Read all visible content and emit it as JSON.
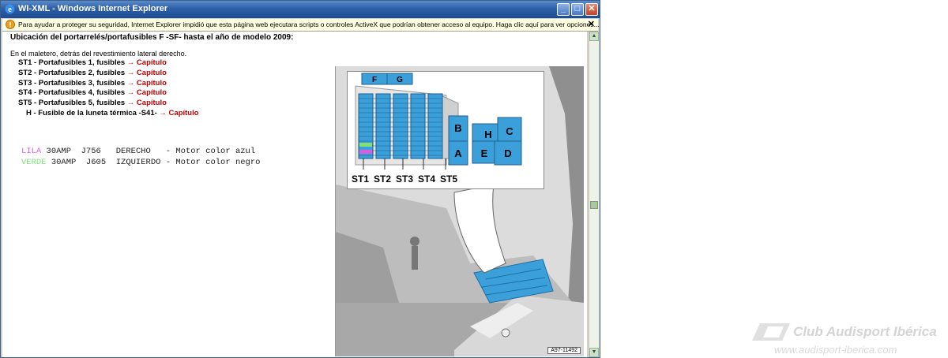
{
  "window": {
    "title": "WI-XML - Windows Internet Explorer"
  },
  "infobar": {
    "text": "Para ayudar a proteger su seguridad, Internet Explorer impidió que esta página web ejecutara scripts o controles ActiveX que podrían obtener acceso al equipo. Haga clic aquí para ver opciones...",
    "close": "✕"
  },
  "page": {
    "heading": "Ubicación del portarrelés/portafusibles F -SF- hasta el año de modelo 2009:",
    "location": "En el maletero, detrás del revestimiento lateral derecho.",
    "items": [
      {
        "label": "ST1 - Portafusibles 1, fusibles",
        "link": "→ Capítulo"
      },
      {
        "label": "ST2 - Portafusibles 2, fusibles",
        "link": "→ Capítulo"
      },
      {
        "label": "ST3 - Portafusibles 3, fusibles",
        "link": "→ Capítulo"
      },
      {
        "label": "ST4 - Portafusibles 4, fusibles",
        "link": "→ Capítulo"
      },
      {
        "label": "ST5 - Portafusibles 5, fusibles",
        "link": "→ Capítulo"
      },
      {
        "label": "H - Fusible de la luneta térmica -S41-",
        "link": "→ Capítulo"
      }
    ],
    "notes": [
      {
        "color_name": "LILA",
        "color": "#d65fe0",
        "text": " 30AMP  J756   DERECHO   - Motor color azul"
      },
      {
        "color_name": "VERDE",
        "color": "#7fe07a",
        "text": " 30AMP  J605  IZQUIERDO - Motor color negro"
      }
    ]
  },
  "figure": {
    "code": "A97-11492",
    "top_labels": [
      "F",
      "G"
    ],
    "relay_labels": [
      "B",
      "H",
      "C",
      "A",
      "E",
      "D"
    ],
    "st_labels": [
      "ST1",
      "ST2",
      "ST3",
      "ST4",
      "ST5"
    ],
    "box_color": "#3b9fd9"
  },
  "watermark": {
    "title": "Club Audisport Ibérica",
    "url": "www.audisport-iberica.com"
  }
}
